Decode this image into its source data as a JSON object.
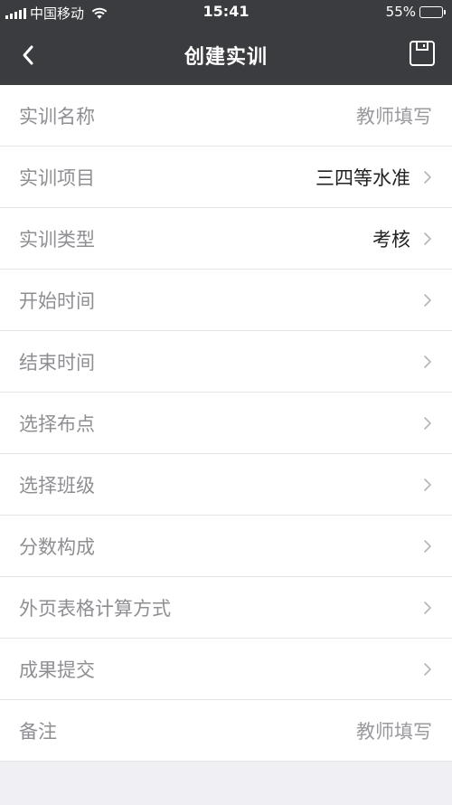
{
  "status_bar": {
    "carrier": "中国移动",
    "time": "15:41",
    "battery": "55%",
    "battery_level": 0.55
  },
  "nav": {
    "back_icon": "chevron-left-icon",
    "title": "创建实训",
    "save_icon": "save-icon"
  },
  "form": {
    "rows": [
      {
        "label": "实训名称",
        "value": "",
        "placeholder": "教师填写",
        "chevron": false
      },
      {
        "label": "实训项目",
        "value": "三四等水准",
        "placeholder": "",
        "chevron": true
      },
      {
        "label": "实训类型",
        "value": "考核",
        "placeholder": "",
        "chevron": true
      },
      {
        "label": "开始时间",
        "value": "",
        "placeholder": "",
        "chevron": true
      },
      {
        "label": "结束时间",
        "value": "",
        "placeholder": "",
        "chevron": true
      },
      {
        "label": "选择布点",
        "value": "",
        "placeholder": "",
        "chevron": true
      },
      {
        "label": "选择班级",
        "value": "",
        "placeholder": "",
        "chevron": true
      },
      {
        "label": "分数构成",
        "value": "",
        "placeholder": "",
        "chevron": true
      },
      {
        "label": "外页表格计算方式",
        "value": "",
        "placeholder": "",
        "chevron": true
      },
      {
        "label": "成果提交",
        "value": "",
        "placeholder": "",
        "chevron": true
      },
      {
        "label": "备注",
        "value": "",
        "placeholder": "教师填写",
        "chevron": false
      }
    ]
  }
}
